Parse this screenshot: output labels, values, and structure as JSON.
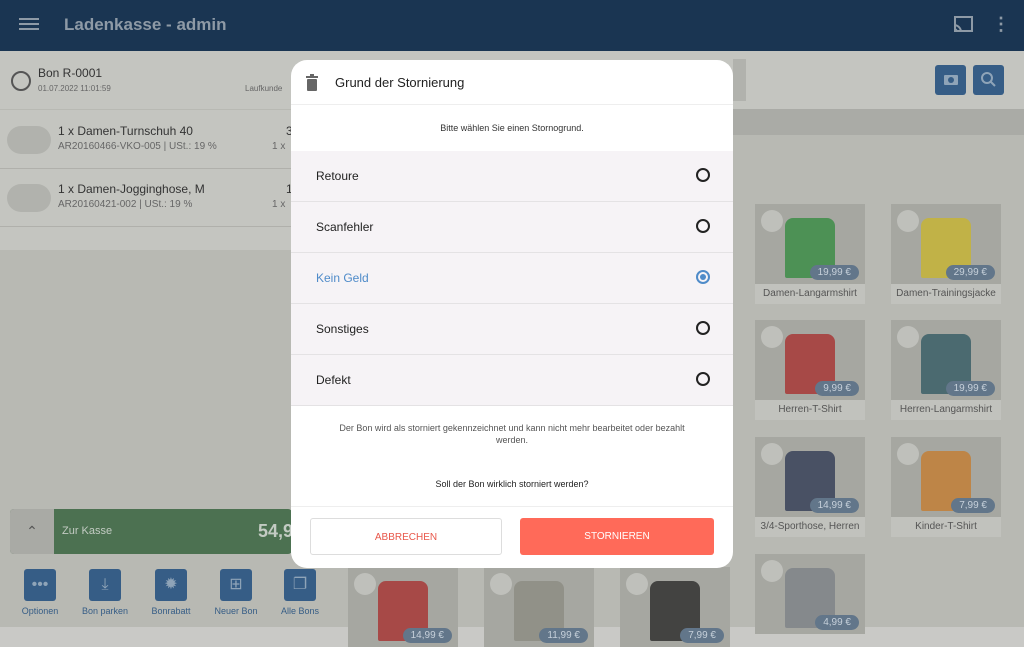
{
  "app": {
    "title": "Ladenkasse - admin"
  },
  "bon": {
    "title": "Bon R-0001",
    "date": "01.07.2022 11:01:59",
    "customer": "Laufkunde"
  },
  "items": [
    {
      "name": "1 x Damen-Turnschuh 40",
      "sub": "AR20160466-VKO-005 | USt.: 19 %",
      "qty": "3",
      "qty2": "1 x"
    },
    {
      "name": "1 x Damen-Jogginghose, M",
      "sub": "AR20160421-002 | USt.: 19 %",
      "qty": "1",
      "qty2": "1 x"
    }
  ],
  "checkout": {
    "label": "Zur Kasse",
    "amount": "54,9"
  },
  "toolbar": [
    {
      "label": "Optionen",
      "icon": "more-horizontal-icon",
      "glyph": "•••"
    },
    {
      "label": "Bon parken",
      "icon": "download-icon",
      "glyph": "⤓"
    },
    {
      "label": "Bonrabatt",
      "icon": "discount-icon",
      "glyph": "✹"
    },
    {
      "label": "Neuer Bon",
      "icon": "add-bon-icon",
      "glyph": "⊞"
    },
    {
      "label": "Alle Bons",
      "icon": "all-bons-icon",
      "glyph": "❐"
    }
  ],
  "products": [
    {
      "name": "Damen-Langarmshirt",
      "price": "19,99 €",
      "color": "#2f8a3c"
    },
    {
      "name": "Damen-Trainingsjacke",
      "price": "29,99 €",
      "color": "#c9b62a"
    },
    {
      "name": "Herren-T-Shirt",
      "price": "9,99 €",
      "color": "#a72a2a"
    },
    {
      "name": "Herren-Langarmshirt",
      "price": "19,99 €",
      "color": "#2c5560"
    },
    {
      "name": "3/4-Sporthose, Herren",
      "price": "14,99 €",
      "color": "#2a3450"
    },
    {
      "name": "Kinder-T-Shirt",
      "price": "7,99 €",
      "color": "#c67a2a"
    },
    {
      "name": "",
      "price": "14,99 €",
      "color": "#a72a2a"
    },
    {
      "name": "",
      "price": "11,99 €",
      "color": "#8a8a80"
    },
    {
      "name": "",
      "price": "7,99 €",
      "color": "#222222"
    },
    {
      "name": "",
      "price": "4,99 €",
      "color": "#7a7f86"
    }
  ],
  "dialog": {
    "title": "Grund der Stornierung",
    "prompt": "Bitte wählen Sie einen Stornogrund.",
    "options": [
      {
        "label": "Retoure",
        "selected": false
      },
      {
        "label": "Scanfehler",
        "selected": false
      },
      {
        "label": "Kein Geld",
        "selected": true
      },
      {
        "label": "Sonstiges",
        "selected": false
      },
      {
        "label": "Defekt",
        "selected": false
      }
    ],
    "note": "Der Bon wird als storniert gekennzeichnet und kann nicht mehr bearbeitet oder bezahlt werden.",
    "question": "Soll der Bon wirklich storniert werden?",
    "cancel_label": "ABBRECHEN",
    "confirm_label": "STORNIEREN"
  },
  "colors": {
    "appbar": "#1a3552",
    "accent": "#ff6a59",
    "selected": "#4f8bc9",
    "checkout": "#4c7151"
  }
}
